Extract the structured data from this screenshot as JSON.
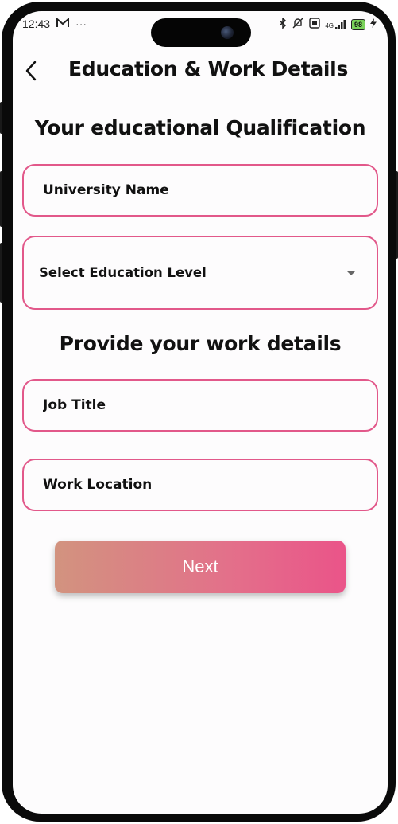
{
  "status_bar": {
    "time": "12:43",
    "mail_icon": "gmail-icon",
    "more_dots": "···",
    "network": "4G",
    "battery": "98"
  },
  "header": {
    "title": "Education & Work Details"
  },
  "education": {
    "heading": "Your educational Qualification",
    "university_placeholder": "University Name",
    "level_label": "Select Education Level"
  },
  "work": {
    "heading": "Provide your work details",
    "job_title_placeholder": "Job Title",
    "work_location_placeholder": "Work Location"
  },
  "actions": {
    "next_label": "Next"
  },
  "colors": {
    "accent_border": "#e2588a",
    "button_gradient_start": "#d2937f",
    "button_gradient_end": "#ea5489"
  }
}
